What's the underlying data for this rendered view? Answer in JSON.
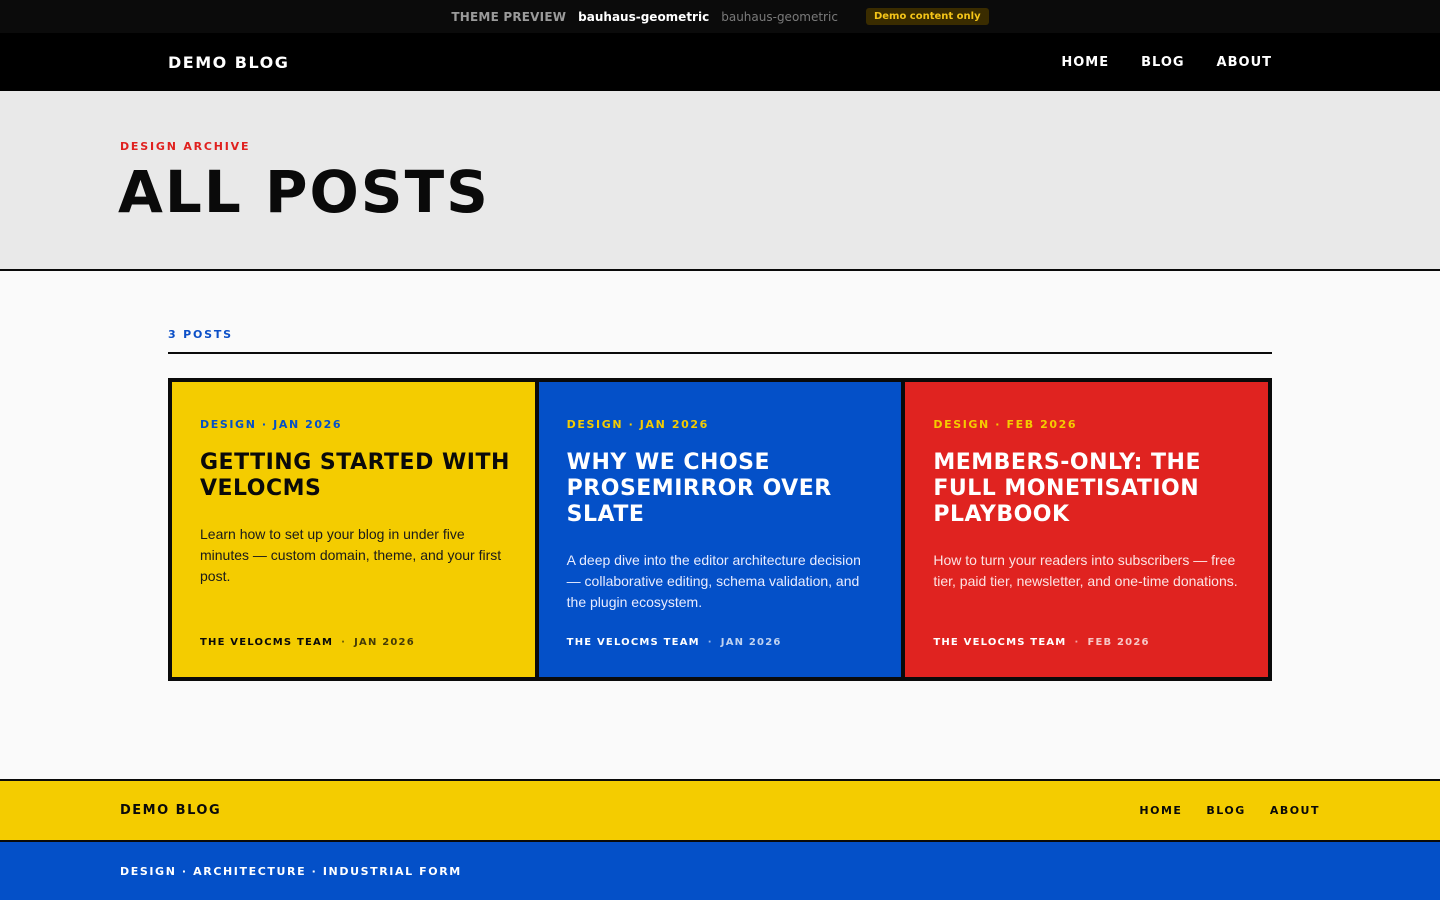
{
  "preview_bar": {
    "label": "THEME PREVIEW",
    "active_theme": "bauhaus-geometric",
    "alt_theme": "bauhaus-geometric",
    "badge": "Demo content only"
  },
  "nav": {
    "brand": "DEMO BLOG",
    "links": [
      "HOME",
      "BLOG",
      "ABOUT"
    ]
  },
  "hero": {
    "eyebrow": "DESIGN ARCHIVE",
    "title": "ALL POSTS"
  },
  "listing": {
    "count_label": "3 POSTS",
    "posts": [
      {
        "meta": "DESIGN · JAN 2026",
        "title": "GETTING STARTED WITH VELOCMS",
        "excerpt": "Learn how to set up your blog in under five minutes — custom domain, theme, and your first post.",
        "author": "THE VELOCMS TEAM",
        "date": "JAN 2026",
        "color": "#f4cc00"
      },
      {
        "meta": "DESIGN · JAN 2026",
        "title": "WHY WE CHOSE PROSEMIRROR OVER SLATE",
        "excerpt": "A deep dive into the editor architecture decision — collaborative editing, schema validation, and the plugin ecosystem.",
        "author": "THE VELOCMS TEAM",
        "date": "JAN 2026",
        "color": "#0450c8"
      },
      {
        "meta": "DESIGN · FEB 2026",
        "title": "MEMBERS-ONLY: THE FULL MONETISATION PLAYBOOK",
        "excerpt": "How to turn your readers into subscribers — free tier, paid tier, newsletter, and one-time donations.",
        "author": "THE VELOCMS TEAM",
        "date": "FEB 2026",
        "color": "#e02320"
      }
    ]
  },
  "footer": {
    "brand": "DEMO BLOG",
    "links": [
      "HOME",
      "BLOG",
      "ABOUT"
    ],
    "tagline": "DESIGN · ARCHITECTURE · INDUSTRIAL FORM"
  }
}
